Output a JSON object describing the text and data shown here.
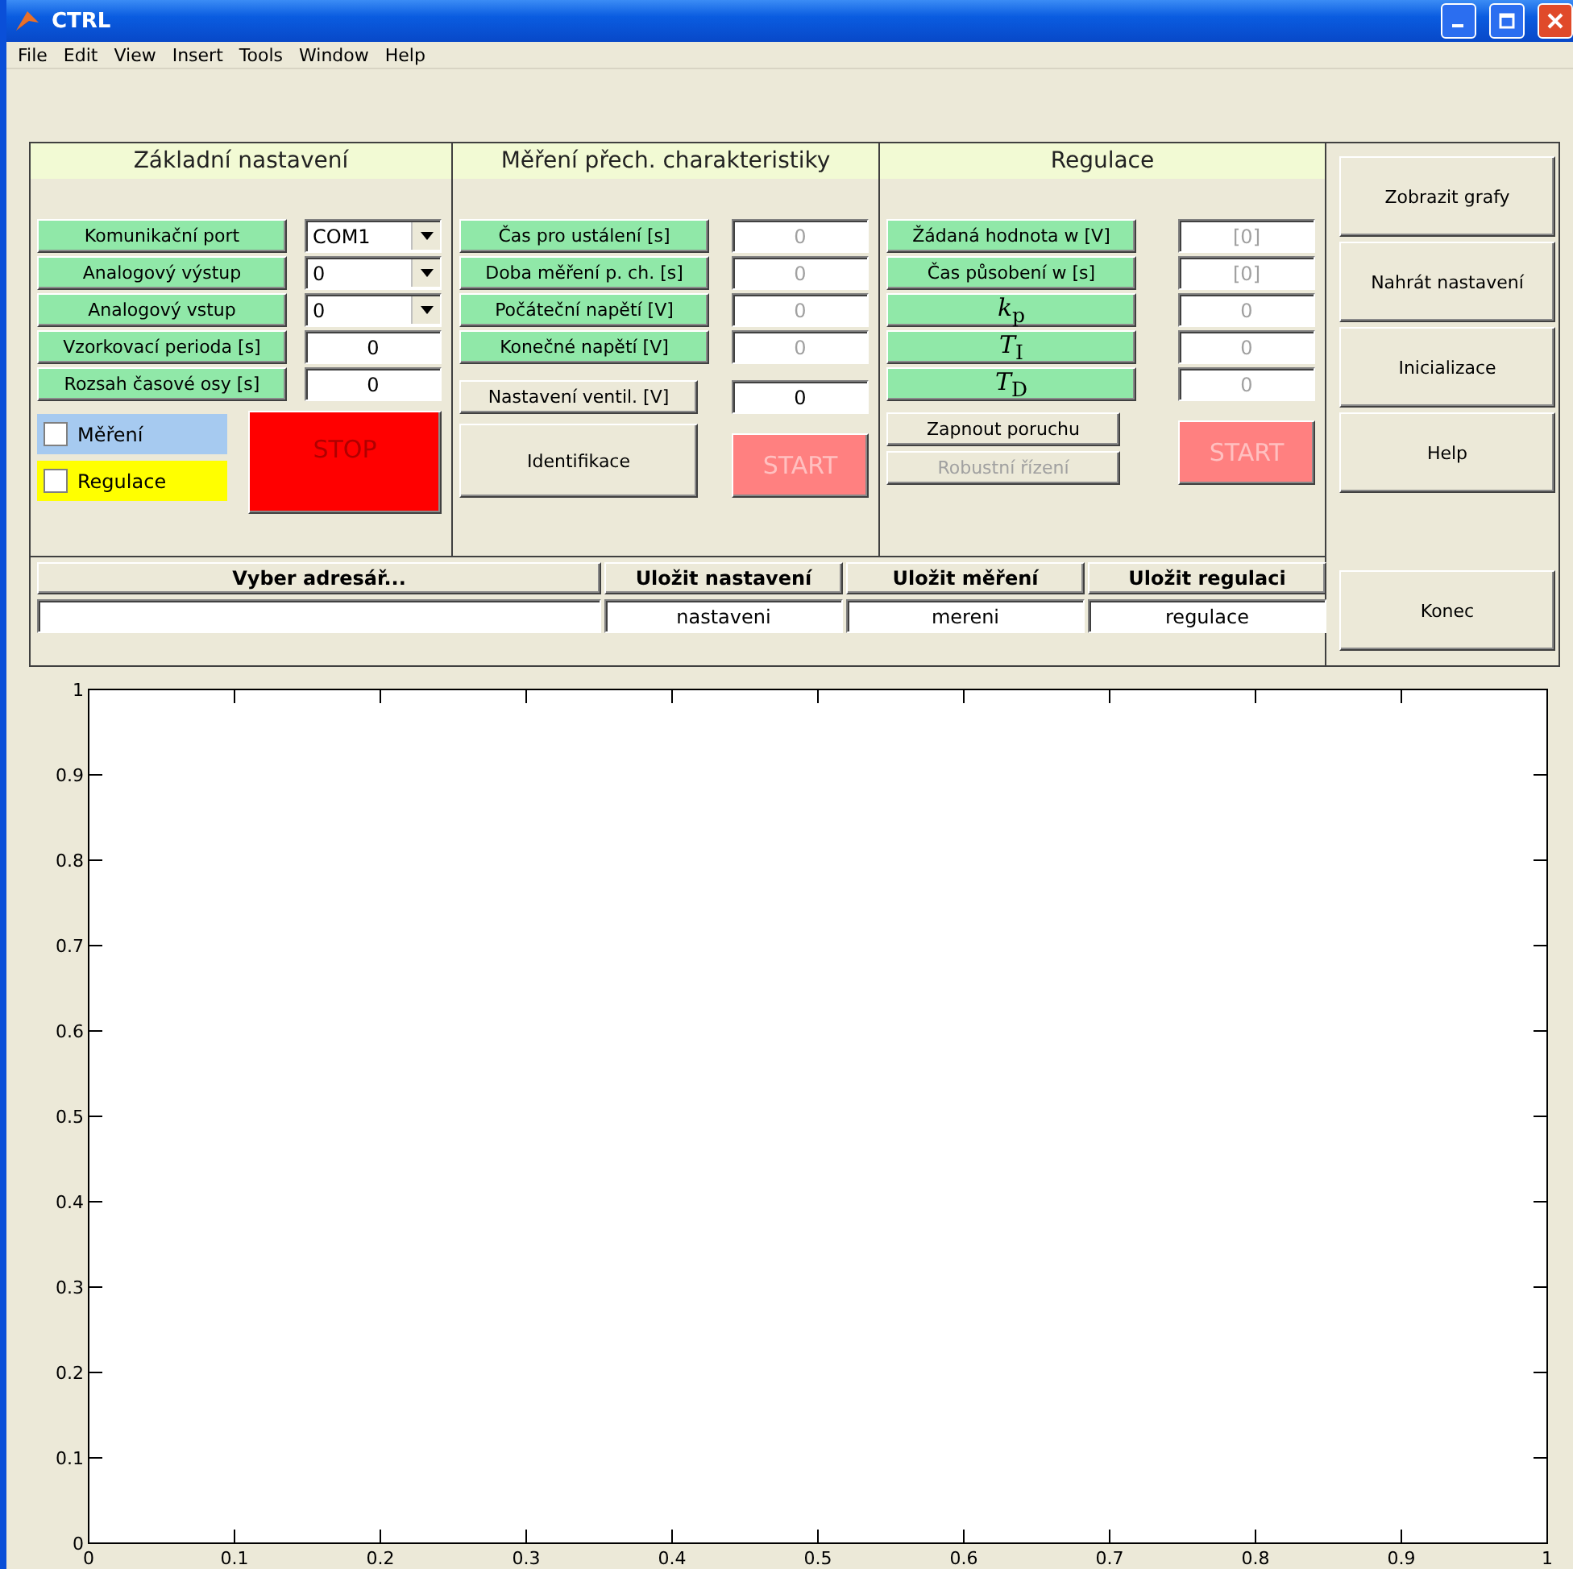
{
  "window": {
    "title": "CTRL"
  },
  "menu": [
    "File",
    "Edit",
    "View",
    "Insert",
    "Tools",
    "Window",
    "Help"
  ],
  "basic": {
    "title": "Základní nastavení",
    "rows": [
      {
        "label": "Komunikační port",
        "kind": "select",
        "value": "COM1",
        "disabled": false
      },
      {
        "label": "Analogový výstup",
        "kind": "select",
        "value": "0",
        "disabled": false
      },
      {
        "label": "Analogový vstup",
        "kind": "select",
        "value": "0",
        "disabled": false
      },
      {
        "label": "Vzorkovací perioda [s]",
        "kind": "field",
        "value": "0",
        "disabled": false
      },
      {
        "label": "Rozsah časové osy [s]",
        "kind": "field",
        "value": "0",
        "disabled": false
      }
    ],
    "checkboxes": [
      {
        "label": "Měření",
        "checked": false,
        "color": "#a6caf0"
      },
      {
        "label": "Regulace",
        "checked": false,
        "color": "#ffff00"
      }
    ],
    "stop": {
      "label": "STOP",
      "disabled": false
    }
  },
  "measure": {
    "title": "Měření přech. charakteristiky",
    "rows": [
      {
        "label": "Čas pro ustálení [s]",
        "kind": "field",
        "value": "0",
        "disabled": true
      },
      {
        "label": "Doba měření p. ch. [s]",
        "kind": "field",
        "value": "0",
        "disabled": true
      },
      {
        "label": "Počáteční napětí [V]",
        "kind": "field",
        "value": "0",
        "disabled": true
      },
      {
        "label": "Konečné napětí [V]",
        "kind": "field",
        "value": "0",
        "disabled": true
      }
    ],
    "valve": {
      "label": "Nastavení ventil. [V]",
      "value": "0",
      "disabled": false
    },
    "identify": {
      "label": "Identifikace",
      "disabled": false
    },
    "start": {
      "label": "START",
      "disabled": true
    }
  },
  "regulation": {
    "title": "Regulace",
    "rows": [
      {
        "label": "Žádaná hodnota w [V]",
        "kind": "field",
        "value": "[0]",
        "disabled": true
      },
      {
        "label": "Čas působení w [s]",
        "kind": "field",
        "value": "[0]",
        "disabled": true
      },
      {
        "label": "*k*$_{p}$",
        "kind": "field",
        "value": "0",
        "disabled": true
      },
      {
        "label": "*T*$_{I}$",
        "kind": "field",
        "value": "0",
        "disabled": true
      },
      {
        "label": "*T*$_{D}$",
        "kind": "field",
        "value": "0",
        "disabled": true
      }
    ],
    "buttons": [
      {
        "label": "Zapnout poruchu",
        "disabled": false
      },
      {
        "label": "Robustní řízení",
        "disabled": true
      }
    ],
    "start": {
      "label": "START",
      "disabled": true
    }
  },
  "side_buttons": [
    "Zobrazit grafy",
    "Nahrát nastavení",
    "Inicializace",
    "Help"
  ],
  "files": [
    {
      "label": "Vyber adresář..."
    },
    {
      "label": "Uložit nastavení",
      "value": "nastaveni"
    },
    {
      "label": "Uložit měření",
      "value": "mereni"
    },
    {
      "label": "Uložit regulaci",
      "value": "regulace"
    }
  ],
  "exit_button": "Konec",
  "plot": {
    "chart_data": {
      "type": "line",
      "xlim": [
        0,
        1
      ],
      "ylim": [
        0,
        1
      ],
      "xticks": [
        {
          "value": 0,
          "label": "0"
        },
        {
          "value": 0.1,
          "label": "0.1"
        },
        {
          "value": 0.2,
          "label": "0.2"
        },
        {
          "value": 0.3,
          "label": "0.3"
        },
        {
          "value": 0.4,
          "label": "0.4"
        },
        {
          "value": 0.5,
          "label": "0.5"
        },
        {
          "value": 0.6,
          "label": "0.6"
        },
        {
          "value": 0.7,
          "label": "0.7"
        },
        {
          "value": 0.8,
          "label": "0.8"
        },
        {
          "value": 0.9,
          "label": "0.9"
        },
        {
          "value": 1,
          "label": "1"
        }
      ],
      "yticks": [
        {
          "value": 0,
          "label": "0"
        },
        {
          "value": 0.1,
          "label": "0.1"
        },
        {
          "value": 0.2,
          "label": "0.2"
        },
        {
          "value": 0.3,
          "label": "0.3"
        },
        {
          "value": 0.4,
          "label": "0.4"
        },
        {
          "value": 0.5,
          "label": "0.5"
        },
        {
          "value": 0.6,
          "label": "0.6"
        },
        {
          "value": 0.7,
          "label": "0.7"
        },
        {
          "value": 0.8,
          "label": "0.8"
        },
        {
          "value": 0.9,
          "label": "0.9"
        },
        {
          "value": 1,
          "label": "1"
        }
      ]
    }
  }
}
